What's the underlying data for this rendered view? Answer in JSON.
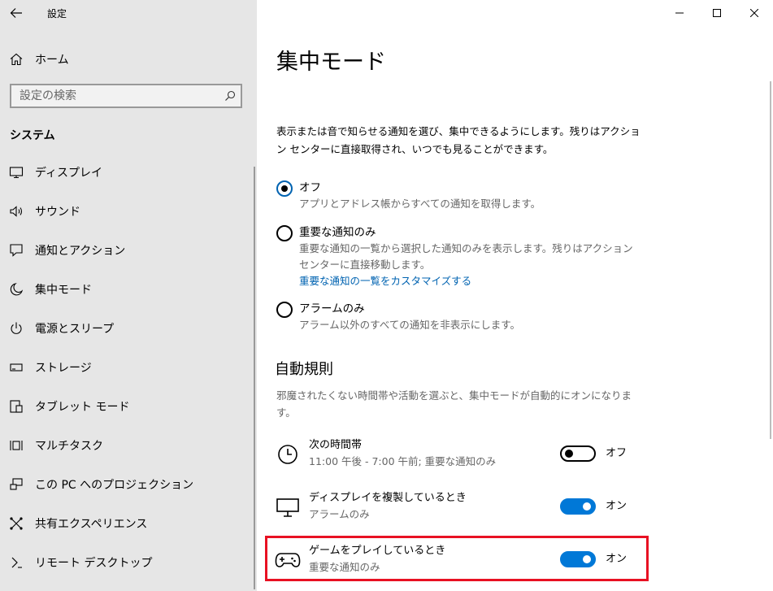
{
  "sidebar": {
    "app_title": "設定",
    "home_label": "ホーム",
    "search_placeholder": "設定の検索",
    "section_header": "システム",
    "items": [
      {
        "label": "ディスプレイ",
        "icon": "monitor-icon"
      },
      {
        "label": "サウンド",
        "icon": "speaker-icon"
      },
      {
        "label": "通知とアクション",
        "icon": "notification-icon"
      },
      {
        "label": "集中モード",
        "icon": "moon-icon"
      },
      {
        "label": "電源とスリープ",
        "icon": "power-icon"
      },
      {
        "label": "ストレージ",
        "icon": "storage-icon"
      },
      {
        "label": "タブレット モード",
        "icon": "tablet-icon"
      },
      {
        "label": "マルチタスク",
        "icon": "multitask-icon"
      },
      {
        "label": "この PC へのプロジェクション",
        "icon": "projection-icon"
      },
      {
        "label": "共有エクスペリエンス",
        "icon": "share-icon"
      },
      {
        "label": "リモート デスクトップ",
        "icon": "remote-desktop-icon"
      }
    ]
  },
  "main": {
    "title": "集中モード",
    "description": "表示または音で知らせる通知を選び、集中できるようにします。残りはアクション センターに直接取得され、いつでも見ることができます。",
    "options": [
      {
        "title": "オフ",
        "desc": "アプリとアドレス帳からすべての通知を取得します。",
        "checked": true
      },
      {
        "title": "重要な通知のみ",
        "desc": "重要な通知の一覧から選択した通知のみを表示します。残りはアクション センターに直接移動します。",
        "link": "重要な通知の一覧をカスタマイズする",
        "checked": false
      },
      {
        "title": "アラームのみ",
        "desc": "アラーム以外のすべての通知を非表示にします。",
        "checked": false
      }
    ],
    "auto_rules_title": "自動規則",
    "auto_rules_desc": "邪魔されたくない時間帯や活動を選ぶと、集中モードが自動的にオンになります。",
    "rules": [
      {
        "title": "次の時間帯",
        "sub": "11:00 午後 - 7:00 午前; 重要な通知のみ",
        "state": "オフ",
        "on": false,
        "icon": "clock-icon"
      },
      {
        "title": "ディスプレイを複製しているとき",
        "sub": "アラームのみ",
        "state": "オン",
        "on": true,
        "icon": "monitor-icon"
      },
      {
        "title": "ゲームをプレイしているとき",
        "sub": "重要な通知のみ",
        "state": "オン",
        "on": true,
        "icon": "gamepad-icon"
      }
    ]
  },
  "colors": {
    "accent": "#0078d7",
    "link": "#0063b1",
    "highlight": "#e81123",
    "sidebar_bg": "#e6e6e6"
  }
}
